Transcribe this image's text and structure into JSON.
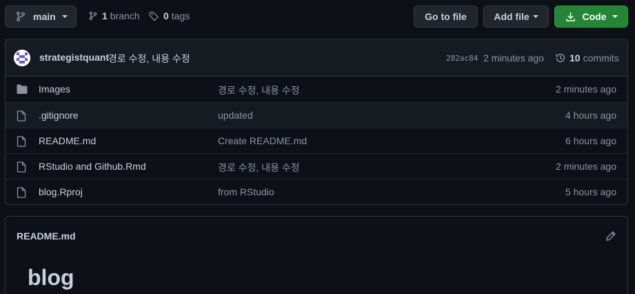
{
  "toolbar": {
    "branch_name": "main",
    "branches_count": "1",
    "branches_label": "branch",
    "tags_count": "0",
    "tags_label": "tags",
    "goto_file_label": "Go to file",
    "add_file_label": "Add file",
    "code_label": "Code",
    "code_button_color": "#238636"
  },
  "latest_commit": {
    "author": "strategistquant",
    "message": "경로 수정, 내용 수정",
    "sha": "282ac84",
    "time": "2 minutes ago",
    "commits_count": "10",
    "commits_label": "commits"
  },
  "files": [
    {
      "icon": "folder-icon",
      "name": "Images",
      "message": "경로 수정, 내용 수정",
      "time": "2 minutes ago"
    },
    {
      "icon": "file-icon",
      "name": ".gitignore",
      "message": "updated",
      "time": "4 hours ago"
    },
    {
      "icon": "file-icon",
      "name": "README.md",
      "message": "Create README.md",
      "time": "6 hours ago"
    },
    {
      "icon": "file-icon",
      "name": "RStudio and Github.Rmd",
      "message": "경로 수정, 내용 수정",
      "time": "2 minutes ago"
    },
    {
      "icon": "file-icon",
      "name": "blog.Rproj",
      "message": "from RStudio",
      "time": "5 hours ago"
    }
  ],
  "readme": {
    "filename": "README.md",
    "heading": "blog"
  }
}
